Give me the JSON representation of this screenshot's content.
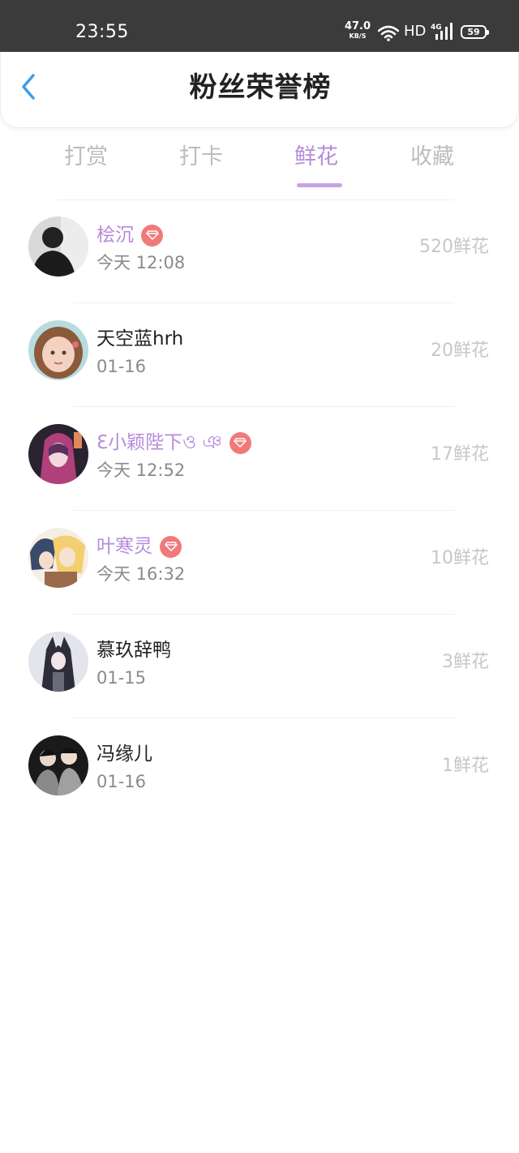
{
  "status_bar": {
    "time": "23:55",
    "net_speed": "47.0",
    "net_unit": "KB/S",
    "hd": "HD",
    "network_type": "4G",
    "battery": "59"
  },
  "header": {
    "back_icon": "chevron-left-icon",
    "title": "粉丝荣誉榜"
  },
  "tabs": [
    {
      "label": "打赏",
      "active": false
    },
    {
      "label": "打卡",
      "active": false
    },
    {
      "label": "鲜花",
      "active": true
    },
    {
      "label": "收藏",
      "active": false
    }
  ],
  "colors": {
    "accent": "#b58bdb",
    "vip_badge": "#f07a7a",
    "back_icon": "#3aa0e8",
    "status_bar": "#3b3b3b"
  },
  "fans": [
    {
      "name": "桧沉",
      "time": "今天 12:08",
      "amount": "520鲜花",
      "vip": true,
      "avatar": "dark-silhouette-avatar"
    },
    {
      "name": "天空蓝hrh",
      "time": "01-16",
      "amount": "20鲜花",
      "vip": false,
      "avatar": "girl-cartoon-avatar"
    },
    {
      "name": "ℇ小颖陛下ও ঞ",
      "time": "今天 12:52",
      "amount": "17鲜花",
      "vip": true,
      "avatar": "anime-hood-avatar"
    },
    {
      "name": "叶寒灵",
      "time": "今天 16:32",
      "amount": "10鲜花",
      "vip": true,
      "avatar": "anime-couple-avatar"
    },
    {
      "name": "慕玖辞鸭",
      "time": "01-15",
      "amount": "3鲜花",
      "vip": false,
      "avatar": "anime-dark-avatar"
    },
    {
      "name": "冯缘儿",
      "time": "01-16",
      "amount": "1鲜花",
      "vip": false,
      "avatar": "two-boys-avatar"
    }
  ]
}
